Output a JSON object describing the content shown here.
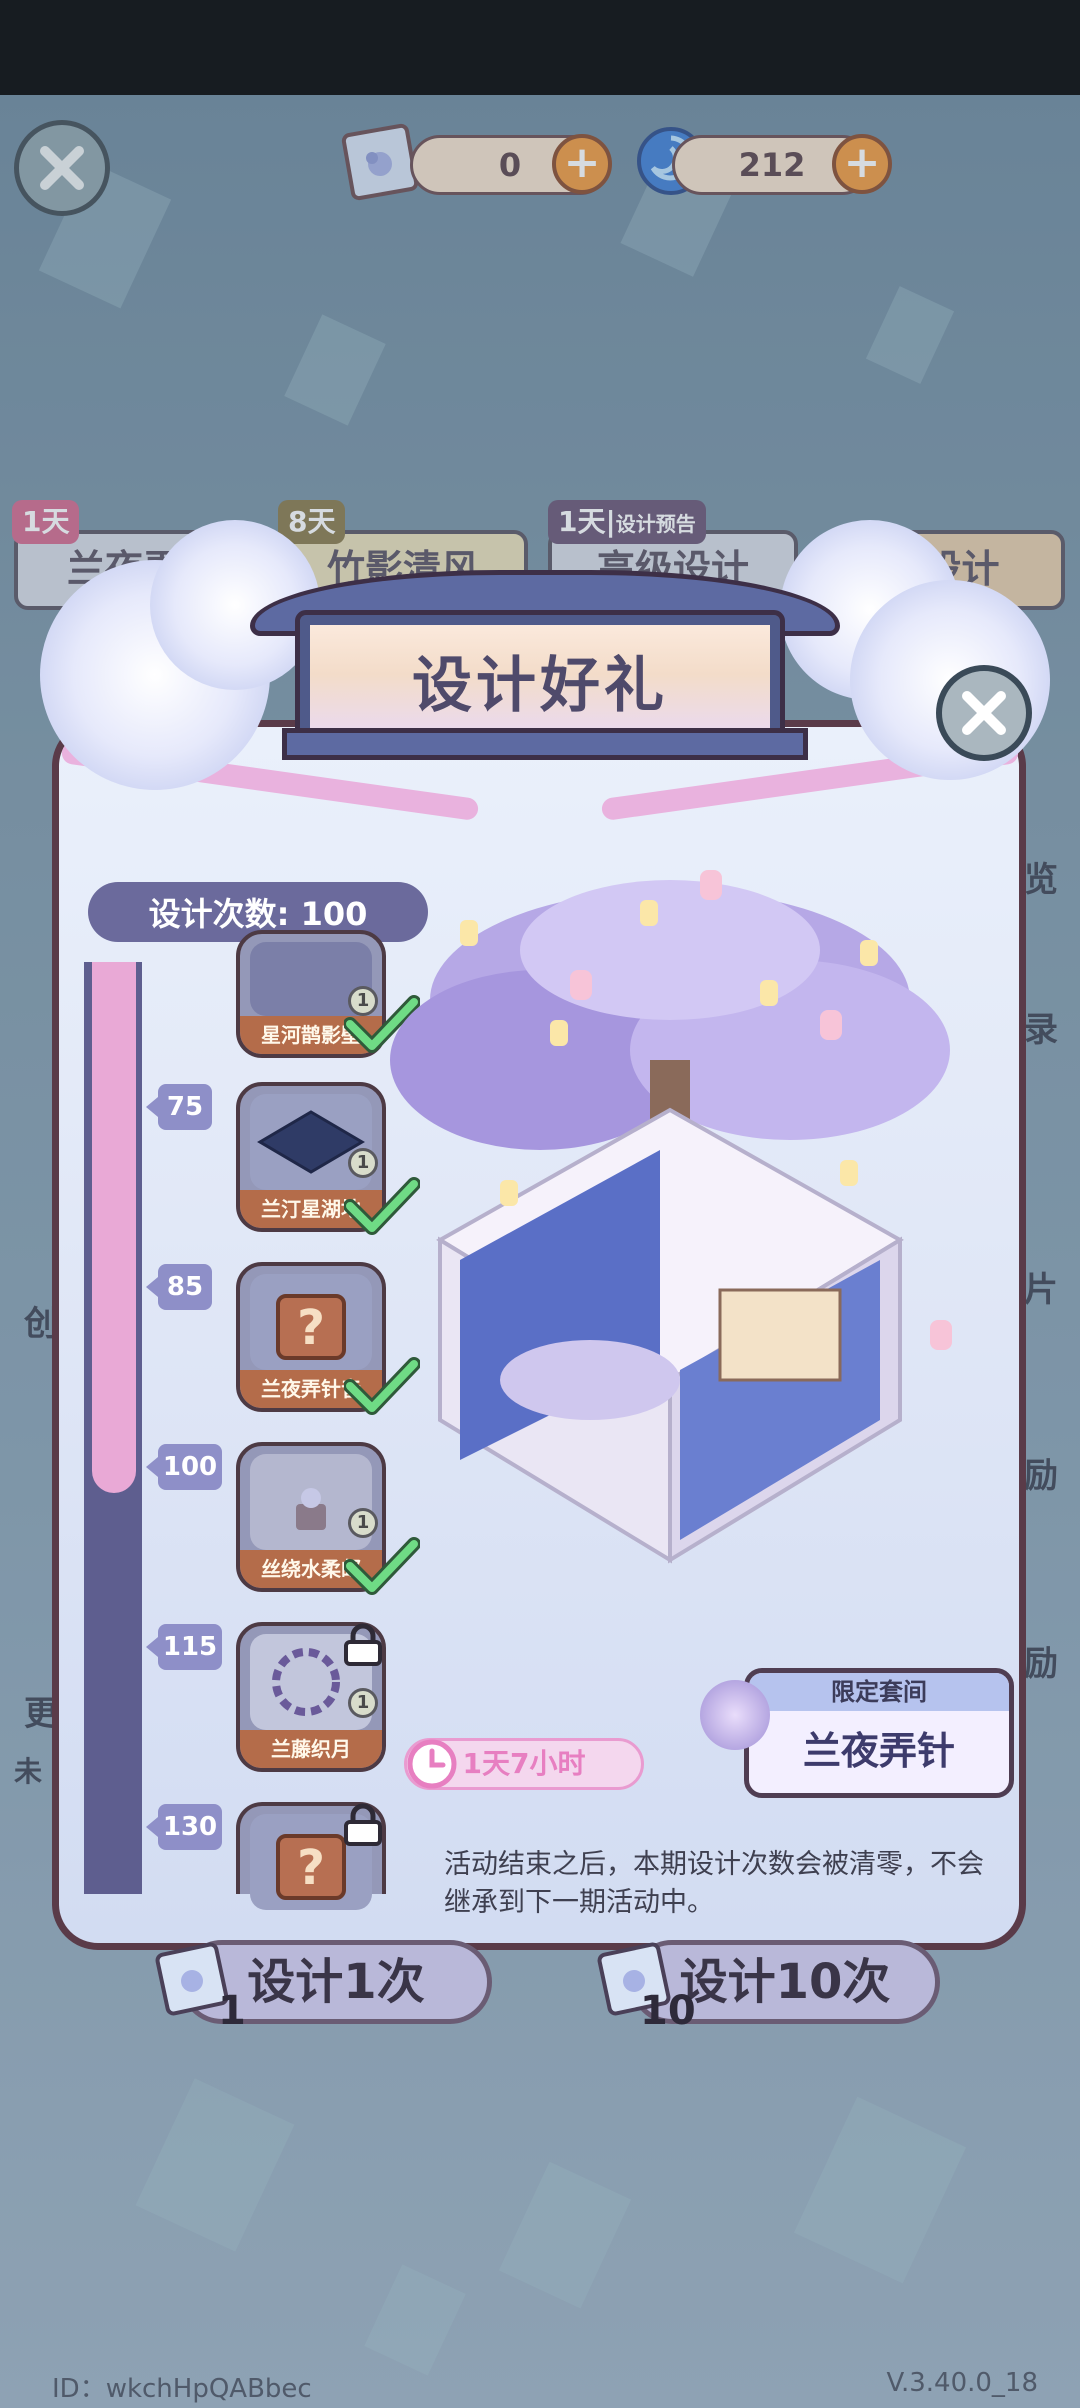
{
  "topbar": {
    "close_icon": "close-x-icon",
    "currency1": {
      "icon": "design-ticket-icon",
      "value": "0"
    },
    "currency2": {
      "icon": "swirl-gem-icon",
      "value": "212"
    }
  },
  "tabs": [
    {
      "badge": "1天",
      "label": "兰夜弄"
    },
    {
      "badge": "8天",
      "label": "竹影清风"
    },
    {
      "badge": "1天",
      "badge_extra": "设计预告",
      "label": "高级设计"
    },
    {
      "badge": "",
      "label": "级设计"
    }
  ],
  "side": {
    "right_labels": [
      "览",
      "录",
      "片",
      "励",
      "励"
    ],
    "left_labels": [
      "创",
      "更",
      "未"
    ]
  },
  "modal": {
    "title": "设计好礼",
    "count_label": "设计次数: 100",
    "milestones": [
      {
        "value": "",
        "name": "星河鹊影壁",
        "qty": "1",
        "status": "claimed"
      },
      {
        "value": "75",
        "name": "兰汀星湖地",
        "qty": "1",
        "status": "claimed"
      },
      {
        "value": "85",
        "name": "兰夜弄针音",
        "qty": "",
        "status": "claimed"
      },
      {
        "value": "100",
        "name": "丝绕水柔邮",
        "qty": "1",
        "status": "claimed"
      },
      {
        "value": "115",
        "name": "兰藤织月",
        "qty": "1",
        "status": "locked"
      },
      {
        "value": "130",
        "name": "",
        "qty": "",
        "status": "locked"
      }
    ],
    "progress_fraction": 0.57,
    "timer": "1天7小时",
    "limited_label": "限定套间",
    "room_name": "兰夜弄针",
    "notice": "活动结束之后，本期设计次数会被清零，不会继承到下一期活动中。"
  },
  "buttons": {
    "draw1": {
      "label": "设计1次",
      "count": "1"
    },
    "draw10": {
      "label": "设计10次",
      "count": "10"
    }
  },
  "footer": {
    "id": "ID：wkchHpQABbec",
    "version": "V.3.40.0_18"
  },
  "colors": {
    "accent_purple": "#6b6a9c",
    "progress_pink": "#e9a9d6",
    "check_green": "#5fd07a"
  }
}
